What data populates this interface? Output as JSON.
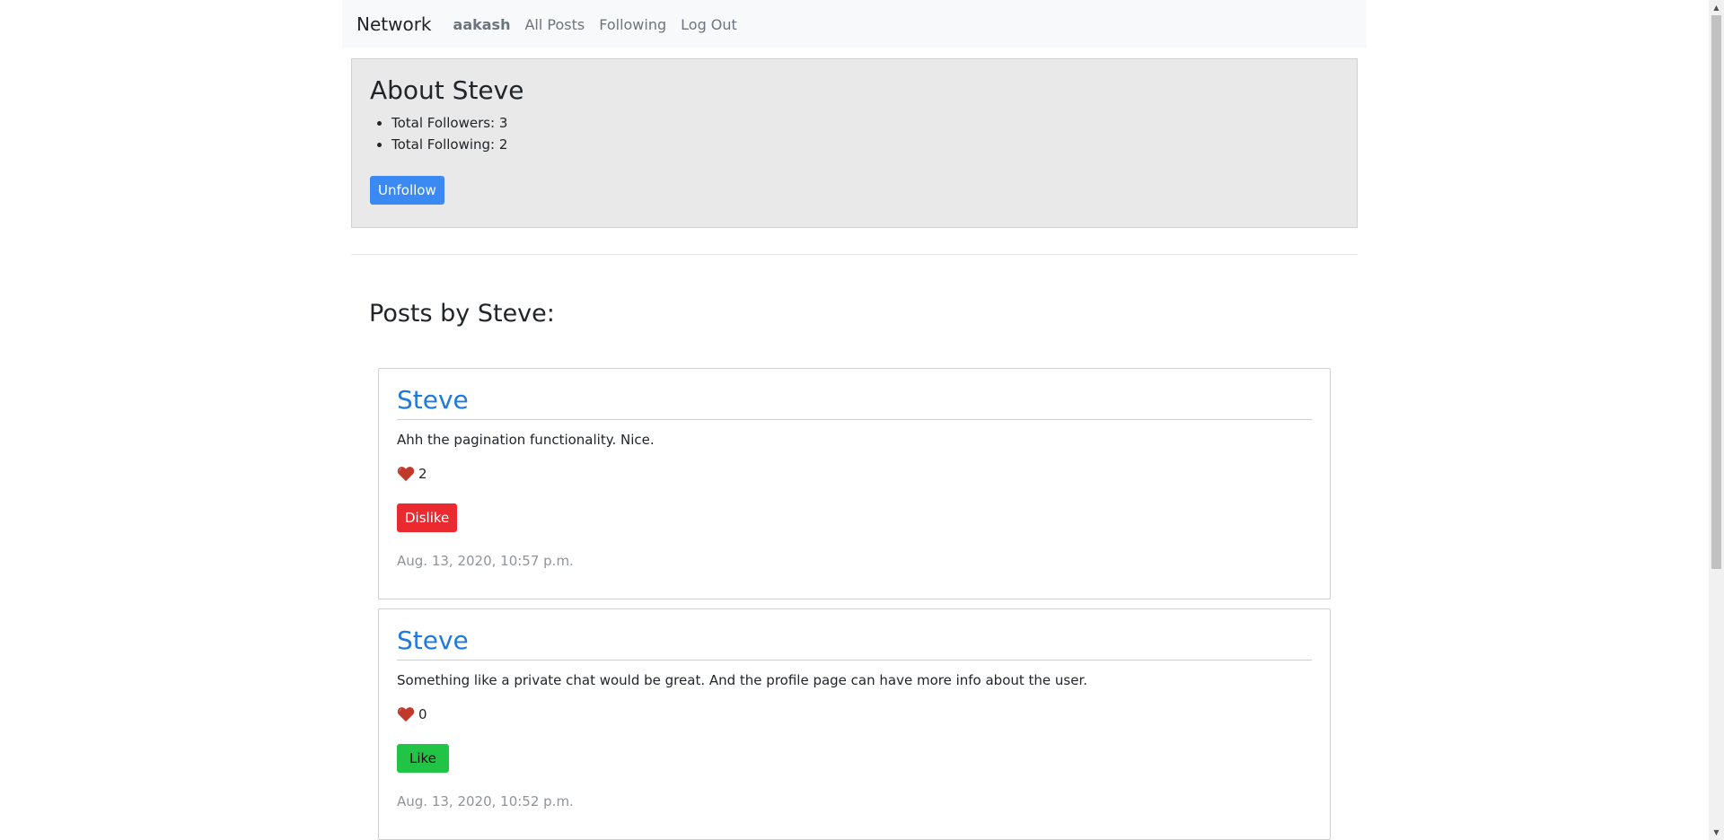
{
  "nav": {
    "brand": "Network",
    "user": "aakash",
    "links": [
      "All Posts",
      "Following",
      "Log Out"
    ]
  },
  "profile": {
    "title": "About Steve",
    "followers": "Total Followers: 3",
    "following": "Total Following: 2",
    "follow_button": "Unfollow"
  },
  "posts_heading": "Posts by Steve:",
  "posts": [
    {
      "author": "Steve",
      "content": "Ahh the pagination functionality. Nice.",
      "likes": "2",
      "action": "Dislike",
      "timestamp": "Aug. 13, 2020, 10:57 p.m."
    },
    {
      "author": "Steve",
      "content": "Something like a private chat would be great. And the profile page can have more info about the user.",
      "likes": "0",
      "action": "Like",
      "timestamp": "Aug. 13, 2020, 10:52 p.m."
    }
  ],
  "colors": {
    "link_blue": "#1f7ae0",
    "unfollow_blue": "#3b8af4",
    "dislike_red": "#eb2a2f",
    "like_green": "#22c446",
    "heart": "#c0392b"
  },
  "icons": {
    "like": "heart-icon"
  }
}
